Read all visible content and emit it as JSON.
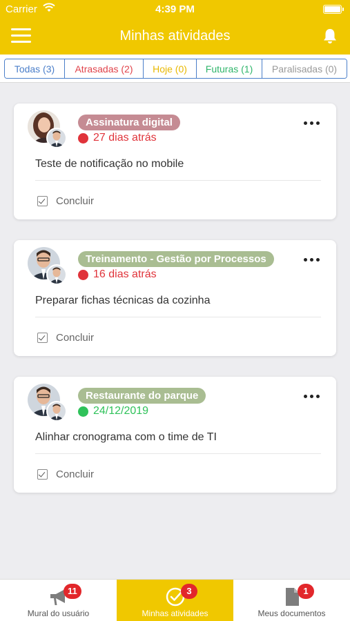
{
  "status_bar": {
    "carrier": "Carrier",
    "time": "4:39 PM"
  },
  "header": {
    "title": "Minhas atividades"
  },
  "filters": [
    {
      "label": "Todas (3)",
      "color": "#4a7ec9"
    },
    {
      "label": "Atrasadas (2)",
      "color": "#e0424a"
    },
    {
      "label": "Hoje (0)",
      "color": "#e8b800"
    },
    {
      "label": "Futuras (1)",
      "color": "#2fb56b"
    },
    {
      "label": "Paralisadas (0)",
      "color": "#999999"
    }
  ],
  "cards": [
    {
      "tag": "Assinatura digital",
      "tag_color": "#c58b93",
      "date": "27 dias atrás",
      "date_color": "#e0333a",
      "description": "Teste de notificação no mobile",
      "action": "Concluir"
    },
    {
      "tag": "Treinamento - Gestão por Processos",
      "tag_color": "#a9bd92",
      "date": "16 dias atrás",
      "date_color": "#e0333a",
      "description": "Preparar fichas técnicas da cozinha",
      "action": "Concluir"
    },
    {
      "tag": "Restaurante do parque",
      "tag_color": "#a9bd92",
      "date": "24/12/2019",
      "date_color": "#2fc25a",
      "description": "Alinhar cronograma com o time de TI",
      "action": "Concluir"
    }
  ],
  "tabbar": [
    {
      "label": "Mural do usuário",
      "badge": "11",
      "icon": "megaphone-icon"
    },
    {
      "label": "Minhas atividades",
      "badge": "3",
      "icon": "check-circle-icon"
    },
    {
      "label": "Meus documentos",
      "badge": "1",
      "icon": "document-icon"
    }
  ]
}
